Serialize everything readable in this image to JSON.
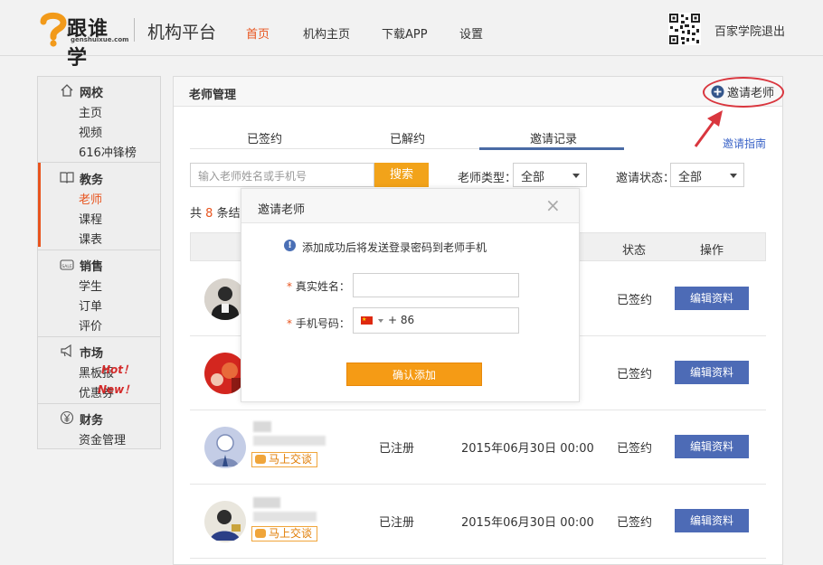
{
  "header": {
    "logo_text": "跟谁学",
    "logo_domain": "genshuixue.com",
    "platform_title": "机构平台",
    "nav": [
      {
        "label": "首页",
        "active": true
      },
      {
        "label": "机构主页",
        "active": false
      },
      {
        "label": "下载APP",
        "active": false
      },
      {
        "label": "设置",
        "active": false
      }
    ],
    "user_name": "百家学院",
    "logout": "退出"
  },
  "sidebar": {
    "groups": [
      {
        "title": "网校",
        "icon": "home-icon",
        "items": [
          "主页",
          "视频",
          "616冲锋榜"
        ]
      },
      {
        "title": "教务",
        "icon": "book-icon",
        "items": [
          "老师",
          "课程",
          "课表"
        ],
        "active_item": "老师"
      },
      {
        "title": "销售",
        "icon": "sale-tag-icon",
        "items": [
          "学生",
          "订单",
          "评价"
        ]
      },
      {
        "title": "市场",
        "icon": "megaphone-icon",
        "items": [
          "黑板报",
          "优惠券"
        ],
        "badges": [
          "Hot！",
          "New！"
        ]
      },
      {
        "title": "财务",
        "icon": "yen-icon",
        "items": [
          "资金管理"
        ]
      }
    ]
  },
  "panel": {
    "title": "老师管理",
    "invite_button": "邀请老师",
    "tabs": [
      "已签约",
      "已解约",
      "邀请记录"
    ],
    "active_tab": "邀请记录",
    "guide_link": "邀请指南",
    "search_placeholder": "输入老师姓名或手机号",
    "search_button": "搜索",
    "filter_type_label": "老师类型：",
    "filter_type_value": "全部",
    "filter_status_label": "邀请状态：",
    "filter_status_value": "全部",
    "total_prefix": "共",
    "total_count": "8",
    "total_suffix": "条结果",
    "columns": [
      "状态",
      "操作"
    ],
    "rows": [
      {
        "status": "已签约",
        "action": "编辑资料"
      },
      {
        "status": "已签约",
        "action": "编辑资料"
      },
      {
        "reg": "已注册",
        "date": "2015年06月30日 00:00",
        "status": "已签约",
        "action": "编辑资料",
        "chat": "马上交谈"
      },
      {
        "reg": "已注册",
        "date": "2015年06月30日 00:00",
        "status": "已签约",
        "action": "编辑资料",
        "chat": "马上交谈"
      }
    ]
  },
  "modal": {
    "title": "邀请老师",
    "info": "添加成功后将发送登录密码到老师手机",
    "name_label": "真实姓名：",
    "phone_label": "手机号码：",
    "required_mark": "*",
    "phone_prefix": "+ 86",
    "confirm_button": "确认添加"
  },
  "colors": {
    "accent_orange": "#e8541e",
    "button_orange": "#f59b15",
    "edit_blue": "#4d6bb6",
    "highlight_red": "#d9363e"
  }
}
